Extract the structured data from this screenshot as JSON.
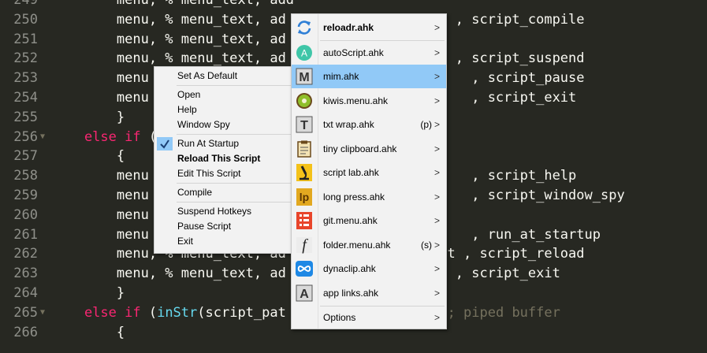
{
  "editor": {
    "lines": [
      {
        "n": "249",
        "segs": [
          {
            "t": "        menu, % menu_text, add",
            "c": ""
          }
        ]
      },
      {
        "n": "250",
        "segs": [
          {
            "t": "        menu, % menu_text, ad",
            "c": ""
          },
          {
            "t": "                     , script_compile",
            "c": ""
          }
        ]
      },
      {
        "n": "251",
        "segs": [
          {
            "t": "        menu, % menu_text, ad",
            "c": ""
          }
        ]
      },
      {
        "n": "252",
        "segs": [
          {
            "t": "        menu, % menu_text, ad",
            "c": ""
          },
          {
            "t": "                     , script_suspend",
            "c": ""
          }
        ]
      },
      {
        "n": "253",
        "segs": [
          {
            "t": "        menu",
            "c": ""
          },
          {
            "t": "                                        , script_pause",
            "c": ""
          }
        ]
      },
      {
        "n": "254",
        "segs": [
          {
            "t": "        menu",
            "c": ""
          },
          {
            "t": "                                        , script_exit",
            "c": ""
          }
        ]
      },
      {
        "n": "255",
        "segs": [
          {
            "t": "        }",
            "c": ""
          }
        ]
      },
      {
        "n": "256",
        "fold": true,
        "segs": [
          {
            "t": "    else if ",
            "c": "kw"
          },
          {
            "t": "(",
            "c": ""
          }
        ]
      },
      {
        "n": "257",
        "segs": [
          {
            "t": "        {",
            "c": ""
          }
        ]
      },
      {
        "n": "258",
        "segs": [
          {
            "t": "        menu",
            "c": ""
          },
          {
            "t": "                                        , script_help",
            "c": ""
          }
        ]
      },
      {
        "n": "259",
        "segs": [
          {
            "t": "        menu",
            "c": ""
          },
          {
            "t": "                                        , script_window_spy",
            "c": ""
          }
        ]
      },
      {
        "n": "260",
        "segs": [
          {
            "t": "        menu",
            "c": ""
          }
        ]
      },
      {
        "n": "261",
        "segs": [
          {
            "t": "        menu",
            "c": ""
          },
          {
            "t": "                                        , run_at_startup",
            "c": ""
          }
        ]
      },
      {
        "n": "262",
        "segs": [
          {
            "t": "        menu, % menu_text, ad",
            "c": ""
          },
          {
            "t": "                   pt , script_reload",
            "c": ""
          }
        ]
      },
      {
        "n": "263",
        "segs": [
          {
            "t": "        menu, % menu_text, ad",
            "c": ""
          },
          {
            "t": "                     , script_exit",
            "c": ""
          }
        ]
      },
      {
        "n": "264",
        "segs": [
          {
            "t": "        }",
            "c": ""
          }
        ]
      },
      {
        "n": "265",
        "fold": true,
        "segs": [
          {
            "t": "    else if ",
            "c": "kw"
          },
          {
            "t": "(",
            "c": ""
          },
          {
            "t": "inStr",
            "c": "fn"
          },
          {
            "t": "(script_pat",
            "c": ""
          },
          {
            "t": "                 )  ",
            "c": ""
          },
          {
            "t": "; piped buffer",
            "c": "cm"
          }
        ]
      },
      {
        "n": "266",
        "segs": [
          {
            "t": "        {",
            "c": ""
          }
        ]
      }
    ]
  },
  "context_menu": {
    "items": [
      {
        "label": "Set As Default",
        "checked": false,
        "bold": false,
        "sep_after": true
      },
      {
        "label": "Open",
        "checked": false,
        "bold": false,
        "sep_after": false
      },
      {
        "label": "Help",
        "checked": false,
        "bold": false,
        "sep_after": false
      },
      {
        "label": "Window Spy",
        "checked": false,
        "bold": false,
        "sep_after": true
      },
      {
        "label": "Run At Startup",
        "checked": true,
        "bold": false,
        "sep_after": false
      },
      {
        "label": "Reload This Script",
        "checked": false,
        "bold": true,
        "sep_after": false
      },
      {
        "label": "Edit This Script",
        "checked": false,
        "bold": false,
        "sep_after": true
      },
      {
        "label": "Compile",
        "checked": false,
        "bold": false,
        "sep_after": true
      },
      {
        "label": "Suspend Hotkeys",
        "checked": false,
        "bold": false,
        "sep_after": false
      },
      {
        "label": "Pause Script",
        "checked": false,
        "bold": false,
        "sep_after": false
      },
      {
        "label": "Exit",
        "checked": false,
        "bold": false,
        "sep_after": false
      }
    ]
  },
  "scripts_menu": {
    "items": [
      {
        "label": "reloadr.ahk",
        "shortcut": "",
        "icon": "reload-icon",
        "bold": true,
        "highlight": false
      },
      {
        "label": "autoScript.ahk",
        "shortcut": "",
        "icon": "letter-a-circle-icon",
        "bold": false,
        "highlight": false
      },
      {
        "label": "mim.ahk",
        "shortcut": "",
        "icon": "letter-m-icon",
        "bold": false,
        "highlight": true
      },
      {
        "label": "kiwis.menu.ahk",
        "shortcut": "",
        "icon": "kiwi-icon",
        "bold": false,
        "highlight": false
      },
      {
        "label": "txt wrap.ahk",
        "shortcut": "(p)",
        "icon": "letter-t-icon",
        "bold": false,
        "highlight": false
      },
      {
        "label": "tiny clipboard.ahk",
        "shortcut": "",
        "icon": "clipboard-icon",
        "bold": false,
        "highlight": false
      },
      {
        "label": "script lab.ahk",
        "shortcut": "",
        "icon": "microscope-icon",
        "bold": false,
        "highlight": false
      },
      {
        "label": "long press.ahk",
        "shortcut": "",
        "icon": "lp-icon",
        "bold": false,
        "highlight": false
      },
      {
        "label": "git.menu.ahk",
        "shortcut": "",
        "icon": "git-menu-icon",
        "bold": false,
        "highlight": false
      },
      {
        "label": "folder.menu.ahk",
        "shortcut": "(s)",
        "icon": "function-f-icon",
        "bold": false,
        "highlight": false
      },
      {
        "label": "dynaclip.ahk",
        "shortcut": "",
        "icon": "infinity-icon",
        "bold": false,
        "highlight": false
      },
      {
        "label": "app links.ahk",
        "shortcut": "",
        "icon": "letter-a-box-icon",
        "bold": false,
        "highlight": false
      }
    ],
    "options_label": "Options",
    "arrow": ">"
  },
  "colors": {
    "editor_bg": "#272822",
    "keyword": "#f92672",
    "function": "#66d9ef",
    "comment": "#75715e",
    "highlight": "#91c9f7"
  }
}
